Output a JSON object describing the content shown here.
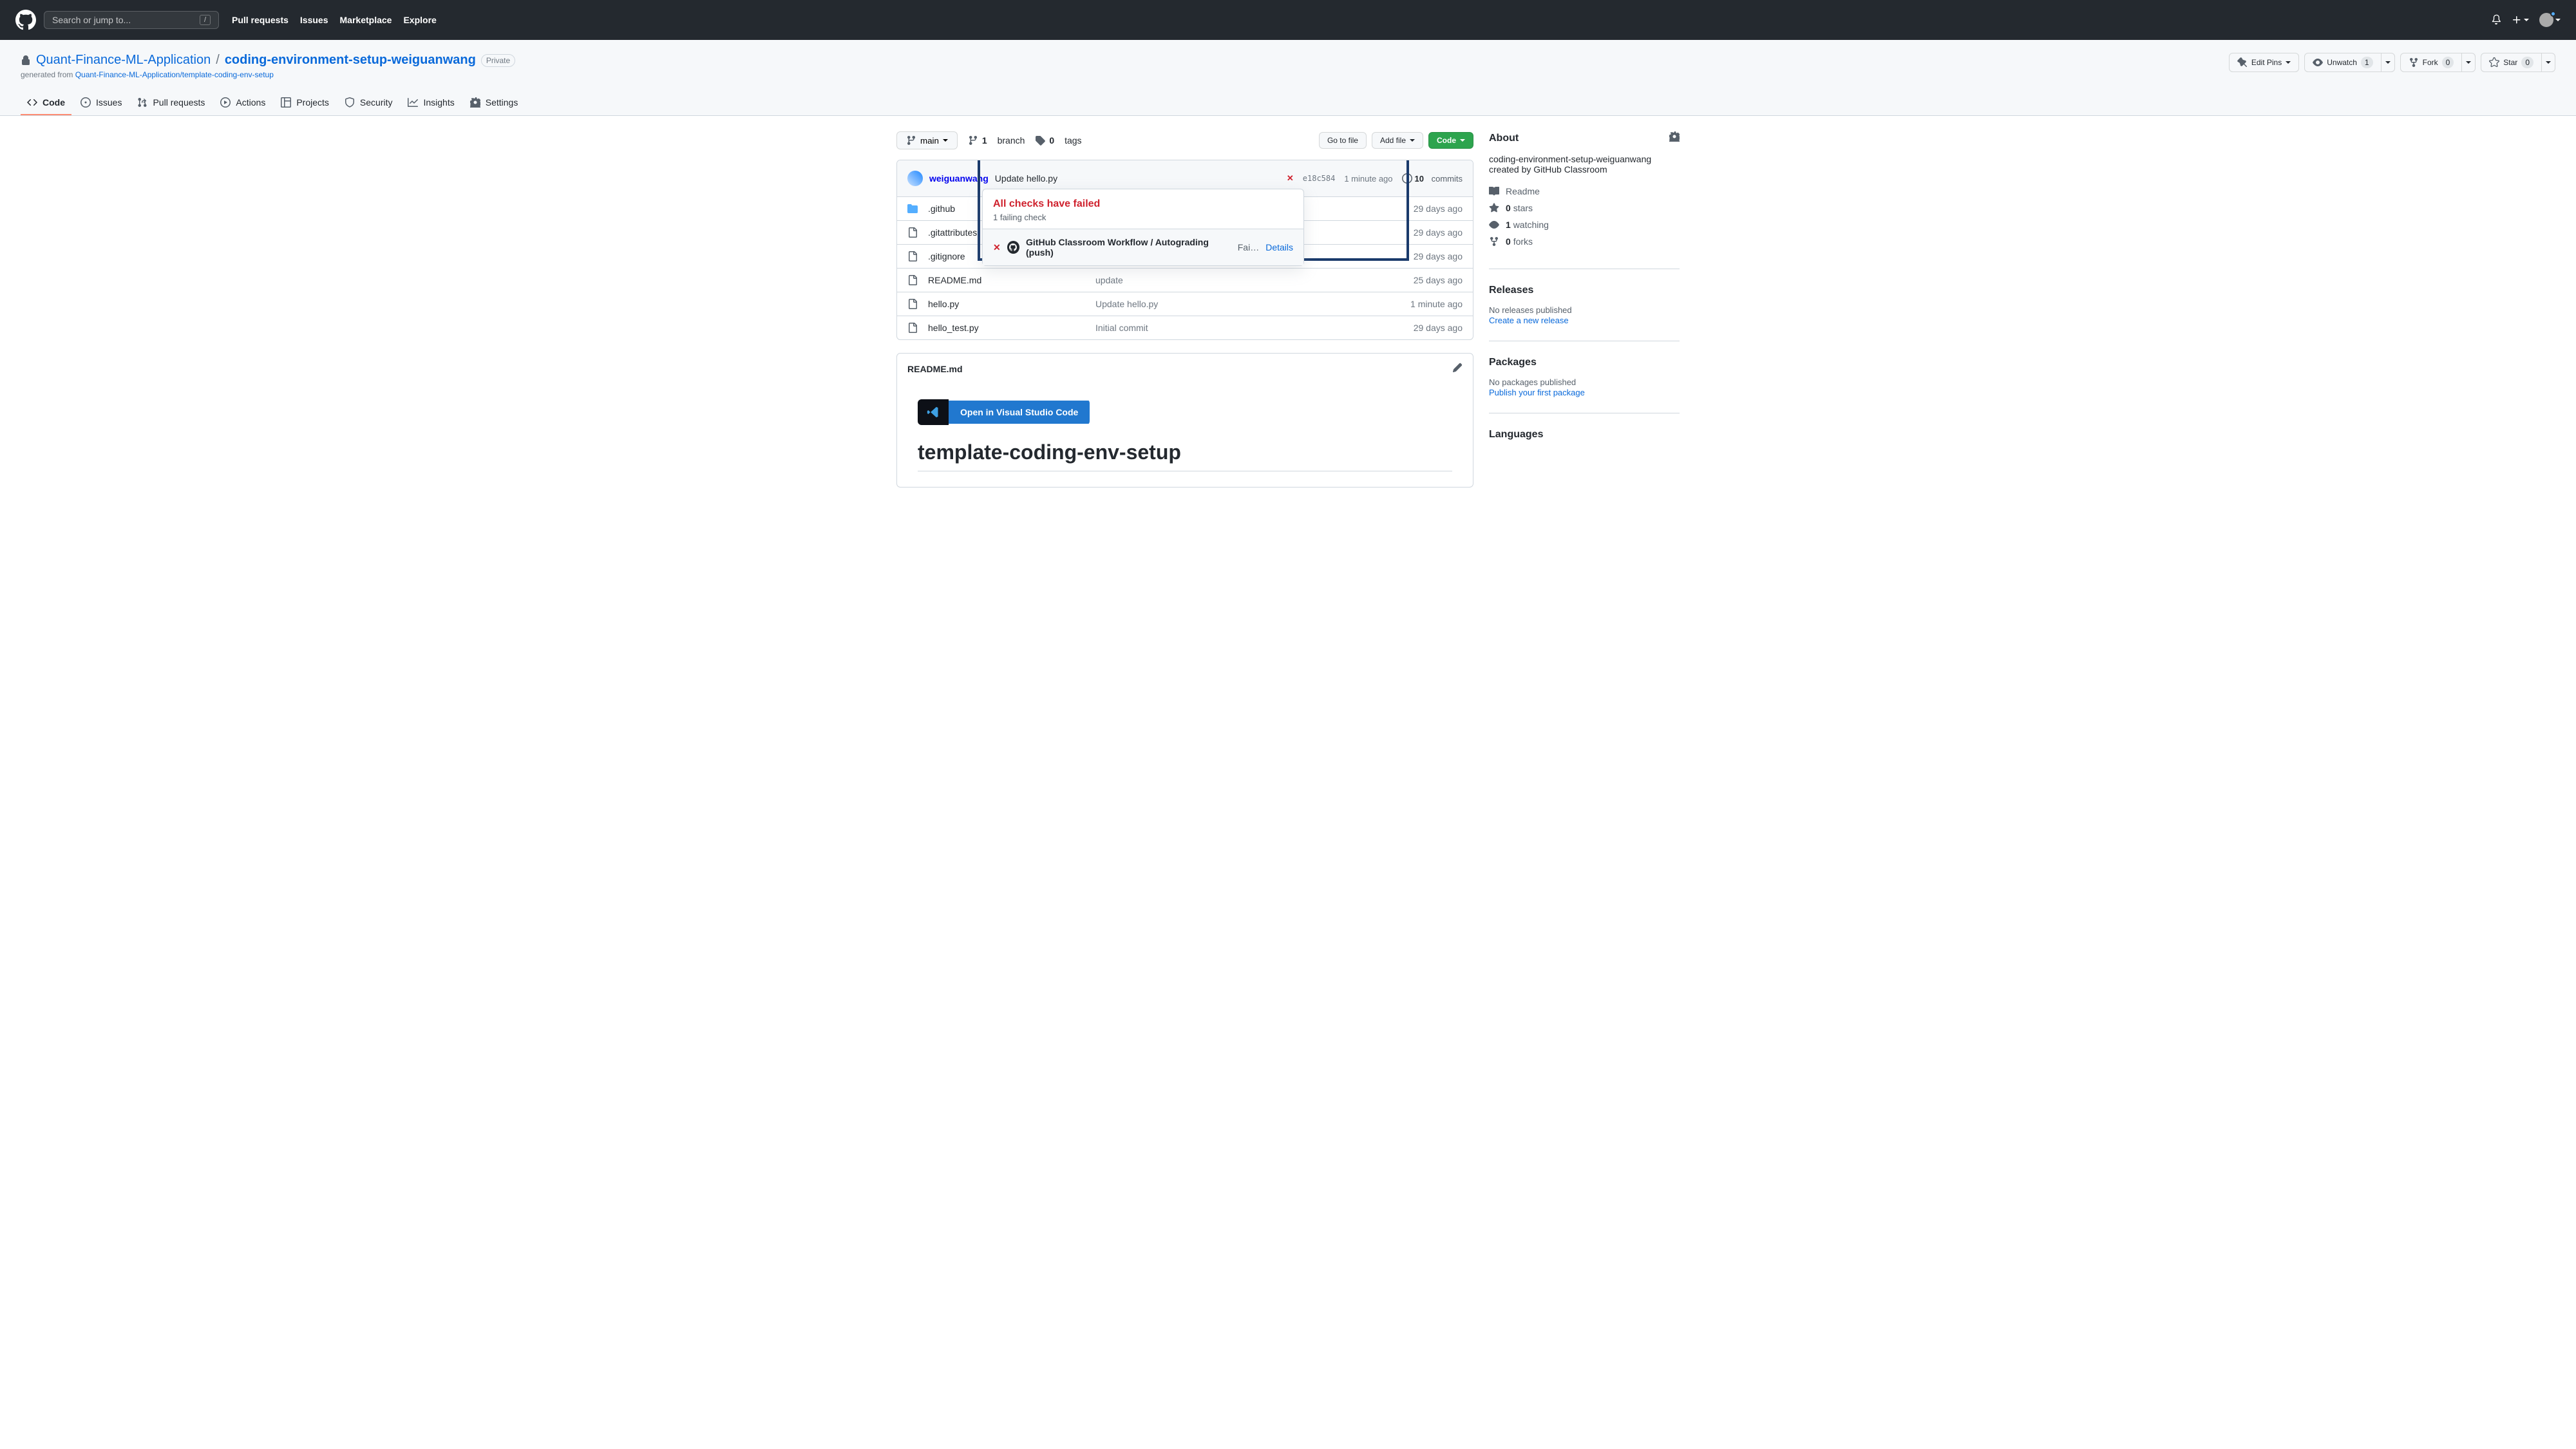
{
  "header": {
    "search_placeholder": "Search or jump to...",
    "slash": "/",
    "nav": {
      "pulls": "Pull requests",
      "issues": "Issues",
      "marketplace": "Marketplace",
      "explore": "Explore"
    }
  },
  "repo": {
    "owner": "Quant-Finance-ML-Application",
    "name": "coding-environment-setup-weiguanwang",
    "visibility": "Private",
    "generated_prefix": "generated from ",
    "generated_link": "Quant-Finance-ML-Application/template-coding-env-setup",
    "actions": {
      "edit_pins": "Edit Pins",
      "unwatch": "Unwatch",
      "unwatch_count": "1",
      "fork": "Fork",
      "fork_count": "0",
      "star": "Star",
      "star_count": "0"
    }
  },
  "tabs": {
    "code": "Code",
    "issues": "Issues",
    "pulls": "Pull requests",
    "actions": "Actions",
    "projects": "Projects",
    "security": "Security",
    "insights": "Insights",
    "settings": "Settings"
  },
  "file_nav": {
    "branch": "main",
    "branch_count": "1",
    "branch_label": "branch",
    "tag_count": "0",
    "tag_label": "tags",
    "go_to_file": "Go to file",
    "add_file": "Add file",
    "code": "Code"
  },
  "commit": {
    "author": "weiguanwang",
    "message": "Update hello.py",
    "hash": "e18c584",
    "time": "1 minute ago",
    "commits_count": "10",
    "commits_label": "commits"
  },
  "checks": {
    "title": "All checks have failed",
    "subtitle": "1 failing check",
    "workflow": "GitHub Classroom Workflow / Autograding (push)",
    "status": "Fai…",
    "details": "Details"
  },
  "files": [
    {
      "icon": "folder",
      "name": ".github",
      "msg": "",
      "date": "29 days ago"
    },
    {
      "icon": "file",
      "name": ".gitattributes",
      "msg": "",
      "date": "29 days ago"
    },
    {
      "icon": "file",
      "name": ".gitignore",
      "msg": "",
      "date": "29 days ago"
    },
    {
      "icon": "file",
      "name": "README.md",
      "msg": "update",
      "date": "25 days ago"
    },
    {
      "icon": "file",
      "name": "hello.py",
      "msg": "Update hello.py",
      "date": "1 minute ago"
    },
    {
      "icon": "file",
      "name": "hello_test.py",
      "msg": "Initial commit",
      "date": "29 days ago"
    }
  ],
  "readme": {
    "filename": "README.md",
    "vscode_label": "Open in Visual Studio Code",
    "h1": "template-coding-env-setup"
  },
  "sidebar": {
    "about": {
      "title": "About",
      "desc": "coding-environment-setup-weiguanwang created by GitHub Classroom"
    },
    "meta": {
      "readme": "Readme",
      "stars_count": "0",
      "stars_label": "stars",
      "watching_count": "1",
      "watching_label": "watching",
      "forks_count": "0",
      "forks_label": "forks"
    },
    "releases": {
      "title": "Releases",
      "none": "No releases published",
      "create": "Create a new release"
    },
    "packages": {
      "title": "Packages",
      "none": "No packages published",
      "publish": "Publish your first package"
    },
    "languages": {
      "title": "Languages"
    }
  }
}
